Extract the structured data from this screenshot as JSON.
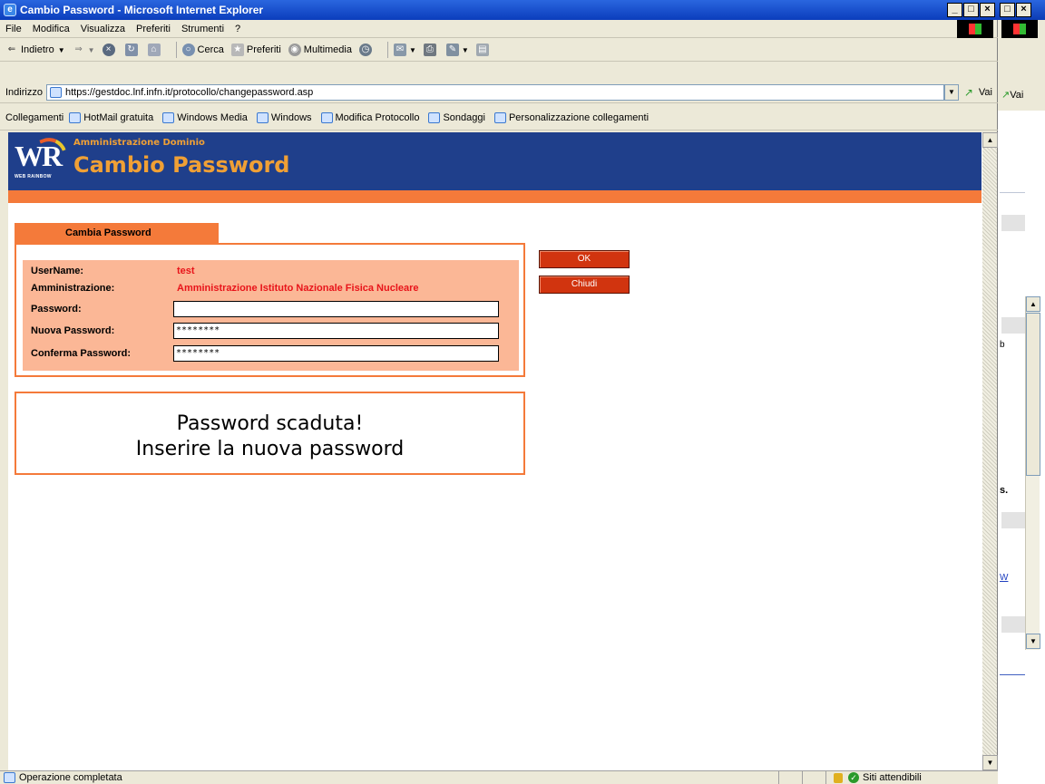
{
  "window": {
    "title": "Cambio Password - Microsoft Internet Explorer",
    "min": "_",
    "max": "□",
    "close": "×"
  },
  "menu": [
    "File",
    "Modifica",
    "Visualizza",
    "Preferiti",
    "Strumenti",
    "?"
  ],
  "toolbar": {
    "back": "Indietro",
    "search": "Cerca",
    "favorites": "Preferiti",
    "media": "Multimedia"
  },
  "address": {
    "label": "Indirizzo",
    "url": "https://gestdoc.lnf.infn.it/protocollo/changepassword.asp",
    "go": "Vai"
  },
  "links": {
    "label": "Collegamenti",
    "items": [
      "HotMail gratuita",
      "Windows Media",
      "Windows",
      "Modifica Protocollo",
      "Sondaggi",
      "Personalizzazione collegamenti"
    ]
  },
  "header": {
    "logo_text": "WR",
    "logo_sub": "WEB RAINBOW",
    "admin_label": "Amministrazione Dominio",
    "title": "Cambio Password"
  },
  "form": {
    "tab_label": "Cambia Password",
    "username_label": "UserName:",
    "username_value": "test",
    "admin_label": "Amministrazione:",
    "admin_value": "Amministrazione Istituto Nazionale Fisica Nucleare",
    "password_label": "Password:",
    "password_value": "",
    "new_password_label": "Nuova Password:",
    "new_password_value": "********",
    "confirm_password_label": "Conferma Password:",
    "confirm_password_value": "********",
    "ok_label": "OK",
    "close_label": "Chiudi"
  },
  "message": {
    "line1": "Password scaduta!",
    "line2": "Inserire la nuova password"
  },
  "status": {
    "text": "Operazione completata",
    "zone": "Siti attendibili"
  },
  "background_window": {
    "go": "Vai",
    "fragment_s": "s.",
    "fragment_b": "b",
    "fragment_w": "W"
  }
}
